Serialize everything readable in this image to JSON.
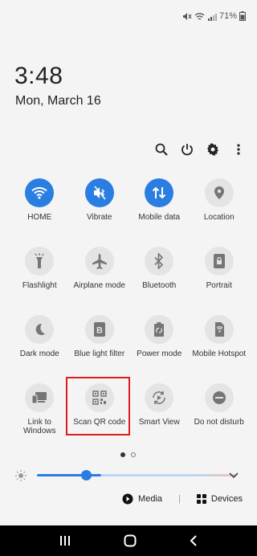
{
  "status": {
    "battery": "71%"
  },
  "clock": {
    "time": "3:48",
    "date": "Mon, March 16"
  },
  "quick_actions": [
    "search-icon",
    "power-icon",
    "gear-icon",
    "more-vert-icon"
  ],
  "tiles": [
    {
      "label": "HOME",
      "icon": "wifi-icon",
      "active": true
    },
    {
      "label": "Vibrate",
      "icon": "vibrate-icon",
      "active": true
    },
    {
      "label": "Mobile data",
      "icon": "mobile-data-icon",
      "active": true
    },
    {
      "label": "Location",
      "icon": "location-icon",
      "active": false
    },
    {
      "label": "Flashlight",
      "icon": "flashlight-icon",
      "active": false
    },
    {
      "label": "Airplane mode",
      "icon": "airplane-icon",
      "active": false
    },
    {
      "label": "Bluetooth",
      "icon": "bluetooth-icon",
      "active": false
    },
    {
      "label": "Portrait",
      "icon": "portrait-lock-icon",
      "active": false
    },
    {
      "label": "Dark mode",
      "icon": "moon-icon",
      "active": false
    },
    {
      "label": "Blue light filter",
      "icon": "blue-light-icon",
      "active": false
    },
    {
      "label": "Power mode",
      "icon": "power-mode-icon",
      "active": false
    },
    {
      "label": "Mobile Hotspot",
      "icon": "hotspot-icon",
      "active": false
    },
    {
      "label": "Link to Windows",
      "icon": "link-windows-icon",
      "active": false
    },
    {
      "label": "Scan QR code",
      "icon": "qr-code-icon",
      "active": false
    },
    {
      "label": "Smart View",
      "icon": "smart-view-icon",
      "active": false
    },
    {
      "label": "Do not disturb",
      "icon": "dnd-icon",
      "active": false
    }
  ],
  "brightness": {
    "level": 0.25
  },
  "media": {
    "media_label": "Media",
    "devices_label": "Devices"
  },
  "colors": {
    "accent": "#2a7de1",
    "highlight": "#e01b1b"
  }
}
